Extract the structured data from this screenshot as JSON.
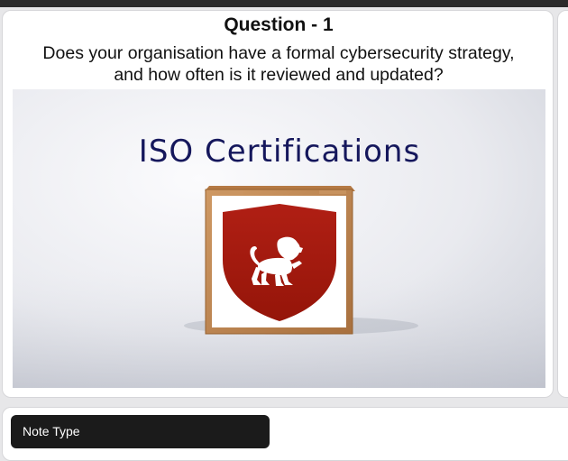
{
  "question": {
    "title": "Question - 1",
    "text": "Does your organisation have a formal cybersecurity strategy, and how often is it reviewed and updated?"
  },
  "media": {
    "headline": "ISO Certifications",
    "emblem_icon": "lion-shield-icon",
    "colors": {
      "headline": "#15175c",
      "shield": "#a41a10",
      "box_frame": "#bf8550"
    }
  },
  "note": {
    "label": "Note Type"
  }
}
